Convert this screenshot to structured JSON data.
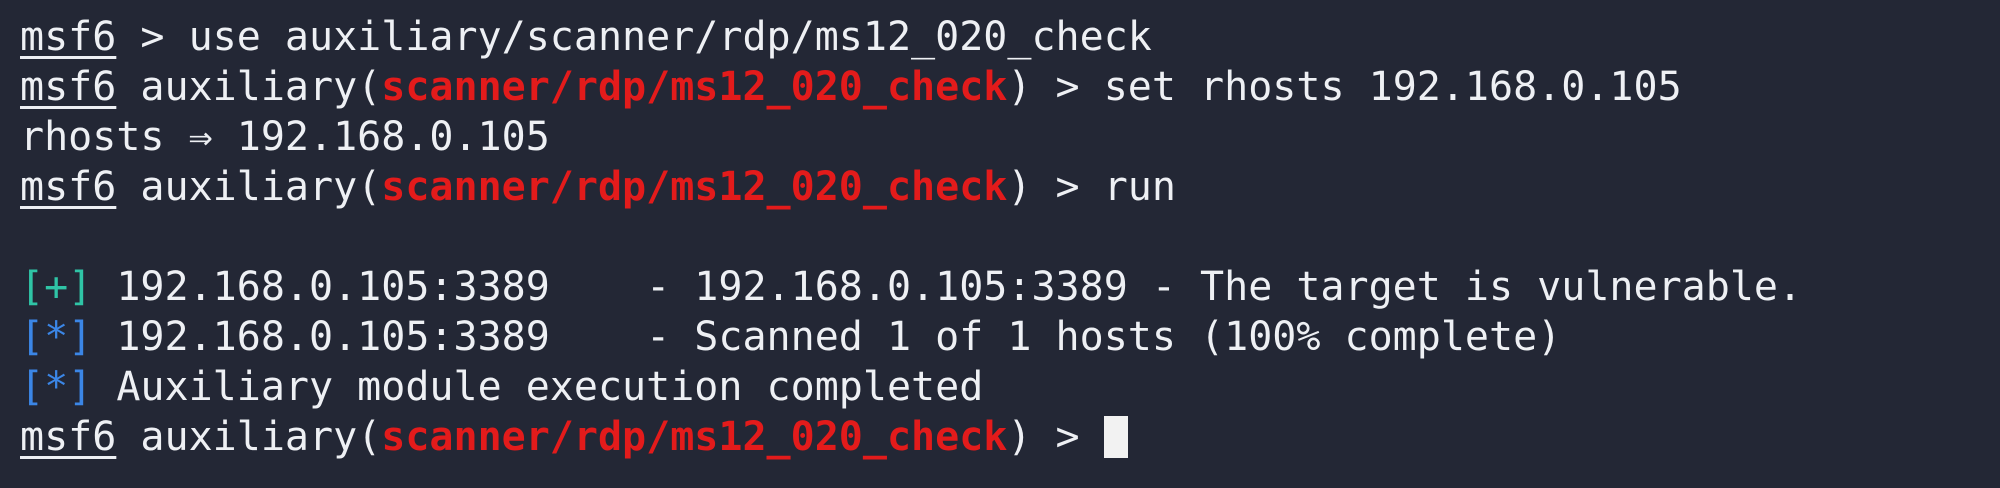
{
  "terminal": {
    "prompt": "msf6",
    "lines": {
      "use_cmd": " > use auxiliary/scanner/rdp/ms12_020_check",
      "module_prefix": " auxiliary(",
      "module_name": "scanner/rdp/ms12_020_check",
      "module_suffix": ") > ",
      "set_cmd": "set rhosts 192.168.0.105",
      "set_result": "rhosts ⇒ 192.168.0.105",
      "run_cmd": "run",
      "result1_tag": "[+]",
      "result1_text": " 192.168.0.105:3389    - 192.168.0.105:3389 - The target is vulnerable.",
      "result2_tag": "[*]",
      "result2_text": " 192.168.0.105:3389    - Scanned 1 of 1 hosts (100% complete)",
      "result3_tag": "[*]",
      "result3_text": " Auxiliary module execution completed"
    },
    "colors": {
      "background": "#232735",
      "text": "#eef0f4",
      "module": "#e31b1b",
      "success_tag": "#2fc4a6",
      "info_tag": "#3b86e6"
    }
  }
}
